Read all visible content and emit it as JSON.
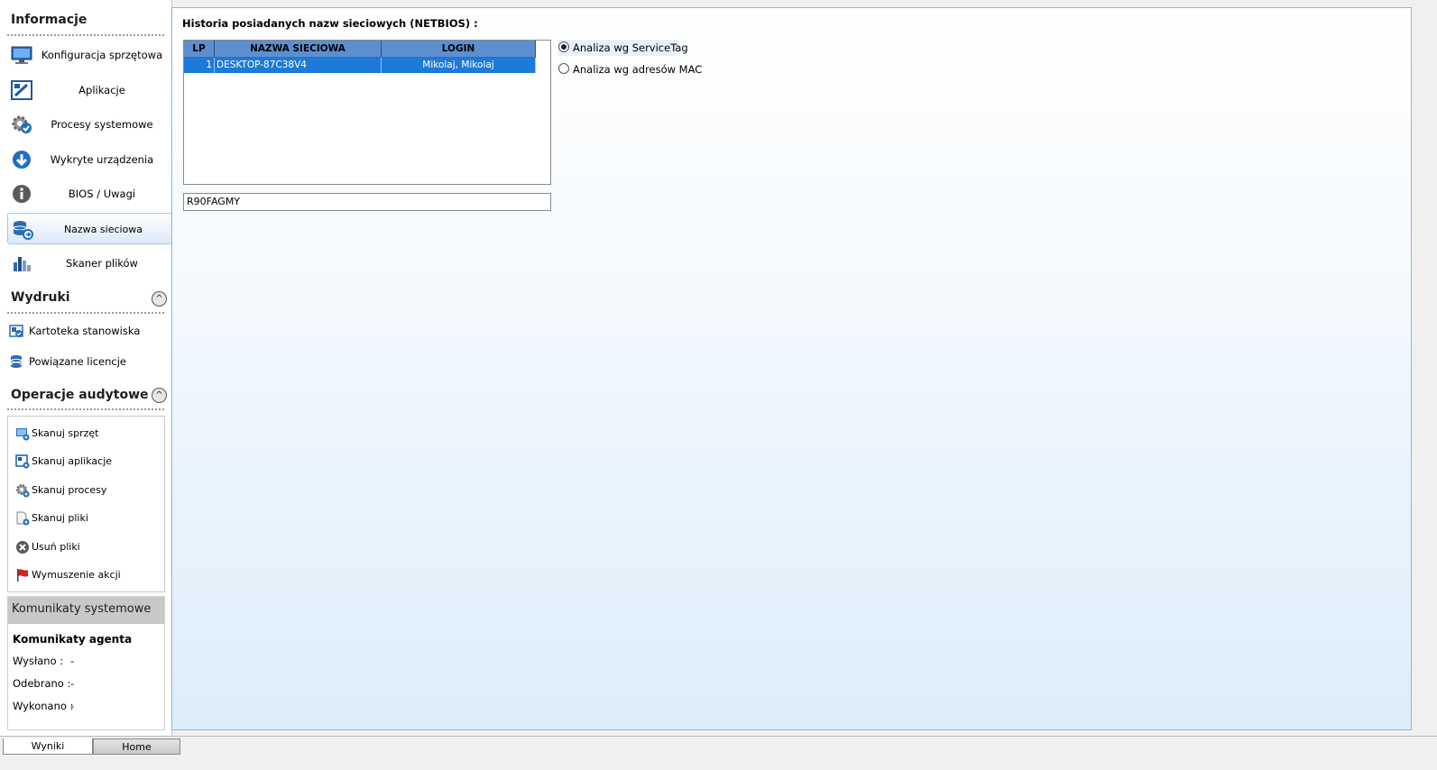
{
  "sidebar": {
    "info_header": "Informacje",
    "info_items": [
      {
        "label": "Konfiguracja sprzętowa",
        "icon": "monitor-icon"
      },
      {
        "label": "Aplikacje",
        "icon": "app-window-icon"
      },
      {
        "label": "Procesy systemowe",
        "icon": "gear-check-icon"
      },
      {
        "label": "Wykryte urządzenia",
        "icon": "arrow-down-circle-icon"
      },
      {
        "label": "BIOS / Uwagi",
        "icon": "info-circle-icon"
      },
      {
        "label": "Nazwa sieciowa",
        "icon": "database-network-icon",
        "active": true
      },
      {
        "label": "Skaner plików",
        "icon": "bar-chart-icon"
      }
    ],
    "prints_header": "Wydruki",
    "prints_items": [
      {
        "label": "Kartoteka stanowiska",
        "icon": "card-check-icon"
      },
      {
        "label": "Powiązane licencje",
        "icon": "stack-icon"
      }
    ],
    "audit_header": "Operacje audytowe",
    "audit_items": [
      {
        "label": "Skanuj sprzęt",
        "icon": "scan-hardware-icon"
      },
      {
        "label": "Skanuj aplikacje",
        "icon": "scan-apps-icon"
      },
      {
        "label": "Skanuj procesy",
        "icon": "scan-process-icon"
      },
      {
        "label": "Skanuj pliki",
        "icon": "scan-files-icon"
      },
      {
        "label": "Usuń pliki",
        "icon": "delete-x-icon"
      },
      {
        "label": "Wymuszenie akcji",
        "icon": "red-flag-icon"
      }
    ],
    "collapse_glyph": "^",
    "system": {
      "header": "Komunikaty systemowe",
      "agent_title": "Komunikaty agenta",
      "sent_label": "Wysłano :",
      "sent_value": "-",
      "received_label": "Odebrano :",
      "received_value": "-",
      "done_label": "Wykonano :",
      "done_value": "-"
    }
  },
  "main": {
    "title": "Historia posiadanych nazw sieciowych (NETBIOS) :",
    "table": {
      "columns": [
        "LP",
        "NAZWA SIECIOWA",
        "LOGIN"
      ],
      "rows": [
        {
          "lp": "1",
          "name": "DESKTOP-87C38V4",
          "login": "Mikolaj, Mikolaj"
        }
      ]
    },
    "service_tag_value": "R90FAGMY",
    "radio_service_tag": "Analiza wg ServiceTag",
    "radio_mac": "Analiza wg adresów MAC"
  },
  "tabs": {
    "wyniki": "Wyniki",
    "home": "Home"
  },
  "colors": {
    "accent": "#1e7ad8",
    "header_blue": "#5c8fd0",
    "panel_border": "#8fb4da",
    "flag_red": "#d42020"
  }
}
